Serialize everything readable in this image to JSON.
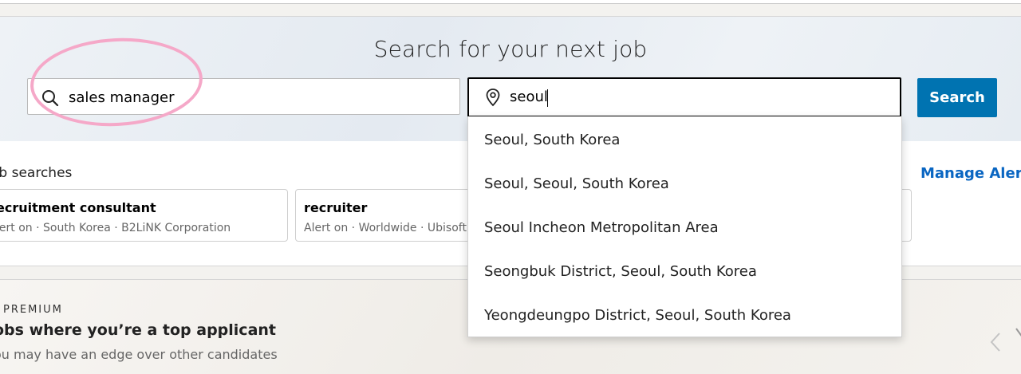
{
  "search": {
    "title": "Search for your next job",
    "keyword_value": "sales manager",
    "location_value": "seoul",
    "button_label": "Search"
  },
  "recent": {
    "label": "ob searches",
    "manage_label": "Manage Alert",
    "alerts": [
      {
        "title": "ecruitment consultant",
        "subtitle": "lert on · South Korea · B2LiNK Corporation"
      },
      {
        "title": "recruiter",
        "subtitle": "Alert on · Worldwide · Ubisoft"
      }
    ]
  },
  "location_suggestions": [
    "Seoul, South Korea",
    "Seoul, Seoul, South Korea",
    "Seoul Incheon Metropolitan Area",
    "Seongbuk District, Seoul, South Korea",
    "Yeongdeungpo District, Seoul, South Korea"
  ],
  "premium": {
    "label": "PREMIUM",
    "title": "obs where you’re a top applicant",
    "subtitle": "ou may have an edge over other candidates"
  },
  "colors": {
    "accent": "#0073b1",
    "highlight": "#f5a8c8"
  },
  "icons": [
    "search-icon",
    "location-pin-icon",
    "chevron-left-icon",
    "chevron-right-icon"
  ]
}
